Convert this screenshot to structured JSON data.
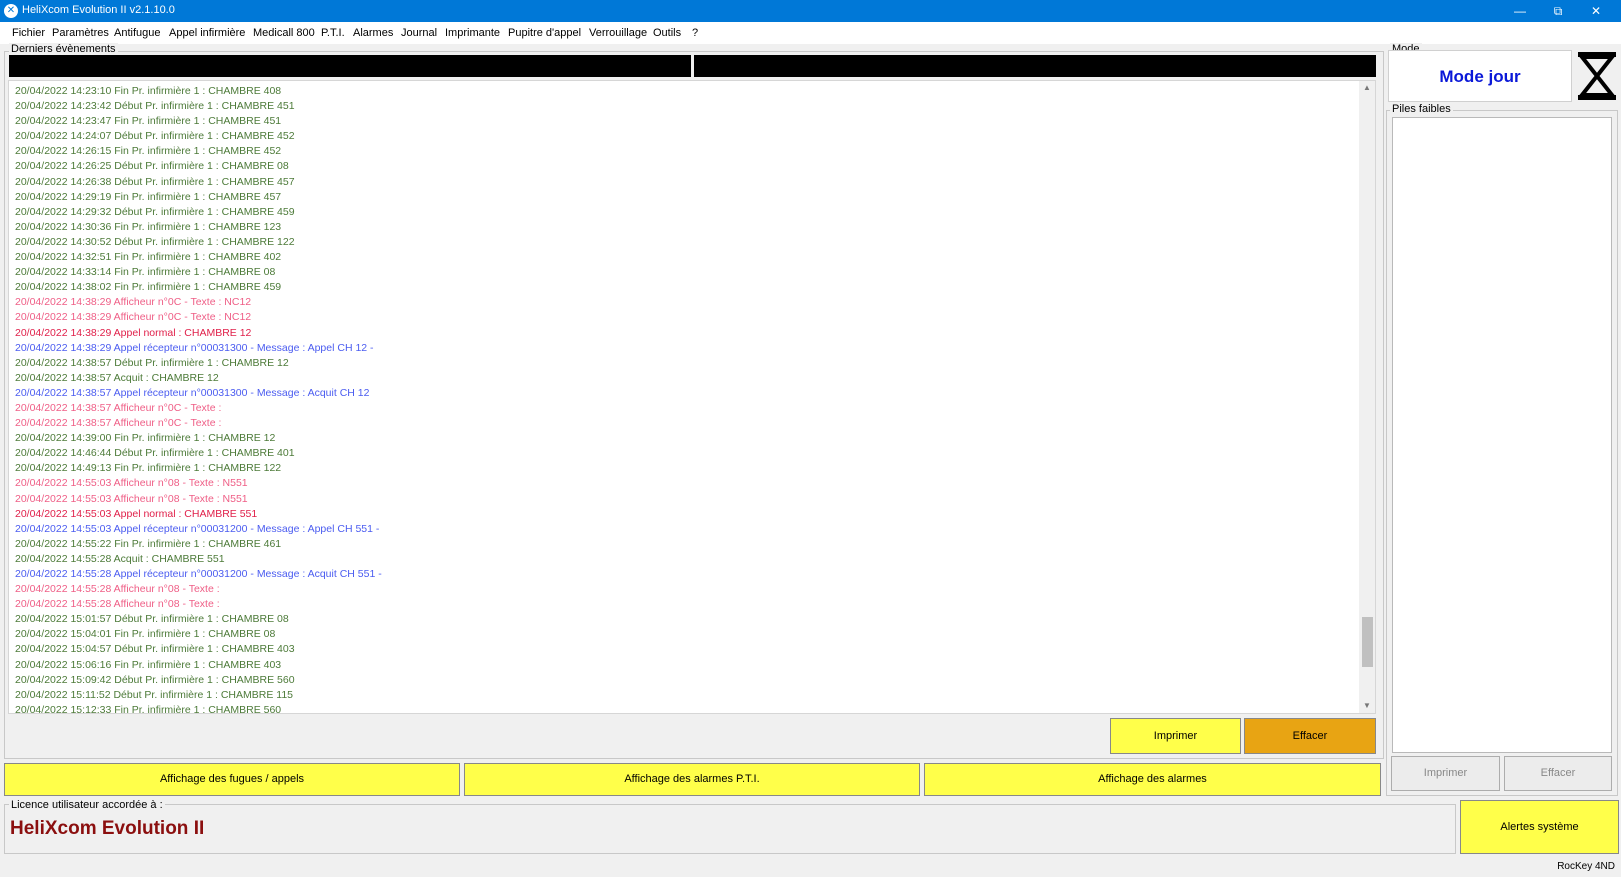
{
  "window": {
    "title": "HeliXcom Evolution II v2.1.10.0",
    "minimize_glyph": "—",
    "restore_glyph": "⧉",
    "close_glyph": "✕"
  },
  "menu": [
    "Fichier",
    "Paramètres",
    "Antifugue",
    "Appel infirmière",
    "Medicall 800",
    "P.T.I.",
    "Alarmes",
    "Journal",
    "Imprimante",
    "Pupitre d'appel",
    "Verrouillage",
    "Outils",
    "?"
  ],
  "events_panel": {
    "label": "Derniers évènements",
    "lines": [
      {
        "text": "20/04/2022 14:23:10 Fin Pr. infirmière 1 : CHAMBRE 408",
        "kind": "green"
      },
      {
        "text": "20/04/2022 14:23:42 Début Pr. infirmière 1 : CHAMBRE 451",
        "kind": "green"
      },
      {
        "text": "20/04/2022 14:23:47 Fin Pr. infirmière 1 : CHAMBRE 451",
        "kind": "green"
      },
      {
        "text": "20/04/2022 14:24:07 Début Pr. infirmière 1 : CHAMBRE 452",
        "kind": "green"
      },
      {
        "text": "20/04/2022 14:26:15 Fin Pr. infirmière 1 : CHAMBRE 452",
        "kind": "green"
      },
      {
        "text": "20/04/2022 14:26:25 Début Pr. infirmière 1 : CHAMBRE 08",
        "kind": "green"
      },
      {
        "text": "20/04/2022 14:26:38 Début Pr. infirmière 1 : CHAMBRE 457",
        "kind": "green"
      },
      {
        "text": "20/04/2022 14:29:19 Fin Pr. infirmière 1 : CHAMBRE 457",
        "kind": "green"
      },
      {
        "text": "20/04/2022 14:29:32 Début Pr. infirmière 1 : CHAMBRE 459",
        "kind": "green"
      },
      {
        "text": "20/04/2022 14:30:36 Fin Pr. infirmière 1 : CHAMBRE 123",
        "kind": "green"
      },
      {
        "text": "20/04/2022 14:30:52 Début Pr. infirmière 1 : CHAMBRE 122",
        "kind": "green"
      },
      {
        "text": "20/04/2022 14:32:51 Fin Pr. infirmière 1 : CHAMBRE 402",
        "kind": "green"
      },
      {
        "text": "20/04/2022 14:33:14 Fin Pr. infirmière 1 : CHAMBRE 08",
        "kind": "green"
      },
      {
        "text": "20/04/2022 14:38:02 Fin Pr. infirmière 1 : CHAMBRE 459",
        "kind": "green"
      },
      {
        "text": "20/04/2022 14:38:29 Afficheur n°0C - Texte : NC12",
        "kind": "pink"
      },
      {
        "text": "20/04/2022 14:38:29 Afficheur n°0C - Texte : NC12",
        "kind": "pink"
      },
      {
        "text": "20/04/2022 14:38:29 Appel normal : CHAMBRE 12",
        "kind": "red"
      },
      {
        "text": "20/04/2022 14:38:29 Appel récepteur n°00031300 - Message : Appel CH 12 -",
        "kind": "blue"
      },
      {
        "text": "20/04/2022 14:38:57 Début Pr. infirmière 1 : CHAMBRE 12",
        "kind": "green"
      },
      {
        "text": "20/04/2022 14:38:57 Acquit : CHAMBRE 12",
        "kind": "green"
      },
      {
        "text": "20/04/2022 14:38:57 Appel récepteur n°00031300 - Message : Acquit CH 12",
        "kind": "blue"
      },
      {
        "text": "20/04/2022 14:38:57 Afficheur n°0C - Texte :",
        "kind": "pink"
      },
      {
        "text": "20/04/2022 14:38:57 Afficheur n°0C - Texte :",
        "kind": "pink"
      },
      {
        "text": "20/04/2022 14:39:00 Fin Pr. infirmière 1 : CHAMBRE 12",
        "kind": "green"
      },
      {
        "text": "20/04/2022 14:46:44 Début Pr. infirmière 1 : CHAMBRE 401",
        "kind": "green"
      },
      {
        "text": "20/04/2022 14:49:13 Fin Pr. infirmière 1 : CHAMBRE 122",
        "kind": "green"
      },
      {
        "text": "20/04/2022 14:55:03 Afficheur n°08 - Texte : N551",
        "kind": "pink"
      },
      {
        "text": "20/04/2022 14:55:03 Afficheur n°08 - Texte : N551",
        "kind": "pink"
      },
      {
        "text": "20/04/2022 14:55:03 Appel normal : CHAMBRE 551",
        "kind": "red"
      },
      {
        "text": "20/04/2022 14:55:03 Appel récepteur n°00031200 - Message : Appel CH 551 -",
        "kind": "blue"
      },
      {
        "text": "20/04/2022 14:55:22 Fin Pr. infirmière 1 : CHAMBRE 461",
        "kind": "green"
      },
      {
        "text": "20/04/2022 14:55:28 Acquit : CHAMBRE 551",
        "kind": "green"
      },
      {
        "text": "20/04/2022 14:55:28 Appel récepteur n°00031200 - Message : Acquit CH 551 -",
        "kind": "blue"
      },
      {
        "text": "20/04/2022 14:55:28 Afficheur n°08 - Texte :",
        "kind": "pink"
      },
      {
        "text": "20/04/2022 14:55:28 Afficheur n°08 - Texte :",
        "kind": "pink"
      },
      {
        "text": "20/04/2022 15:01:57 Début Pr. infirmière 1 : CHAMBRE 08",
        "kind": "green"
      },
      {
        "text": "20/04/2022 15:04:01 Fin Pr. infirmière 1 : CHAMBRE 08",
        "kind": "green"
      },
      {
        "text": "20/04/2022 15:04:57 Début Pr. infirmière 1 : CHAMBRE 403",
        "kind": "green"
      },
      {
        "text": "20/04/2022 15:06:16 Fin Pr. infirmière 1 : CHAMBRE 403",
        "kind": "green"
      },
      {
        "text": "20/04/2022 15:09:42 Début Pr. infirmière 1 : CHAMBRE 560",
        "kind": "green"
      },
      {
        "text": "20/04/2022 15:11:52 Début Pr. infirmière 1 : CHAMBRE 115",
        "kind": "green"
      },
      {
        "text": "20/04/2022 15:12:33 Fin Pr. infirmière 1 : CHAMBRE 560",
        "kind": "green"
      }
    ],
    "print_label": "Imprimer",
    "clear_label": "Effacer"
  },
  "display_buttons": {
    "fugues": "Affichage des fugues / appels",
    "pti": "Affichage des alarmes P.T.I.",
    "alarmes": "Affichage des alarmes"
  },
  "mode": {
    "label": "Mode",
    "value": "Mode jour"
  },
  "piles": {
    "label": "Piles faibles",
    "print_label": "Imprimer",
    "clear_label": "Effacer"
  },
  "license": {
    "label": "Licence utilisateur accordée à :",
    "name": "HeliXcom Evolution II"
  },
  "system_alerts_label": "Alertes système",
  "status": {
    "rockey": "RocKey 4ND"
  },
  "colors": {
    "titlebar": "#0078d7",
    "green": "#4c7a38",
    "red": "#e0204a",
    "pink": "#ef5e86",
    "blue": "#4b5cf0",
    "button_yellow": "#ffff4a",
    "button_orange": "#e8a413",
    "mode_text": "#0a18d8",
    "license_text": "#8b0f0f"
  }
}
